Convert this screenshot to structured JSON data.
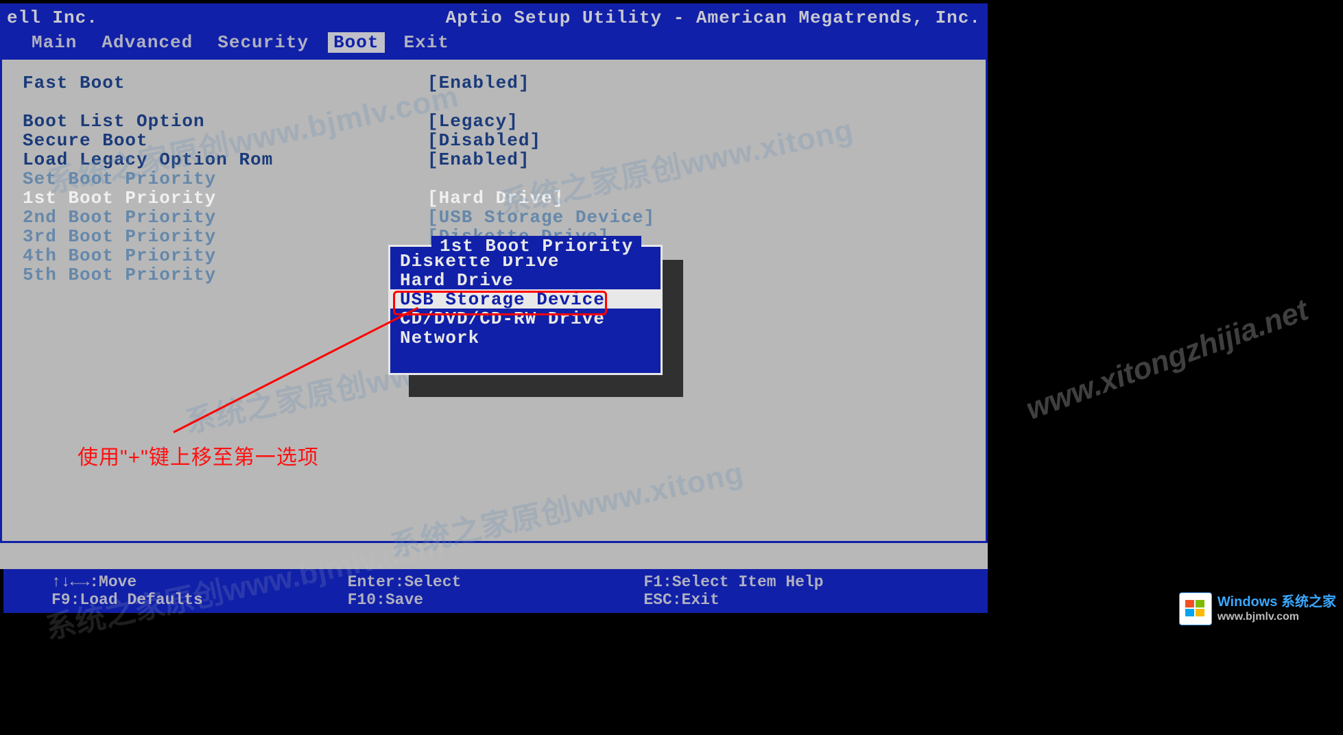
{
  "header": {
    "vendor": "ell Inc.",
    "utility": "Aptio Setup Utility - American Megatrends, Inc.",
    "tabs": [
      "Main",
      "Advanced",
      "Security",
      "Boot",
      "Exit"
    ],
    "active_tab": "Boot"
  },
  "options": {
    "fast_boot": {
      "label": "Fast Boot",
      "value": "[Enabled]"
    },
    "boot_list_option": {
      "label": "Boot List Option",
      "value": "[Legacy]"
    },
    "secure_boot": {
      "label": "Secure Boot",
      "value": "[Disabled]"
    },
    "load_legacy_rom": {
      "label": "Load Legacy Option Rom",
      "value": "[Enabled]"
    },
    "set_boot_priority": {
      "label": "Set Boot Priority",
      "value": ""
    },
    "boot1": {
      "label": "1st Boot Priority",
      "value": "[Hard Drive]"
    },
    "boot2": {
      "label": "2nd Boot Priority",
      "value": "[USB Storage Device]"
    },
    "boot3": {
      "label": "3rd Boot Priority",
      "value": "[Diskette Drive]"
    },
    "boot4": {
      "label": "4th Boot Priority",
      "value": ""
    },
    "boot5": {
      "label": "5th Boot Priority",
      "value": ""
    }
  },
  "popup": {
    "title": "1st Boot Priority",
    "items": [
      "Diskette Drive",
      "Hard Drive",
      "USB Storage Device",
      "CD/DVD/CD-RW Drive",
      "Network"
    ],
    "selected_index": 2
  },
  "annotation": {
    "text": "使用\"+\"键上移至第一选项"
  },
  "footer": {
    "move": "↑↓←→:Move",
    "enter": "Enter:Select",
    "f1": "F1:Select Item Help",
    "f9": "F9:Load Defaults",
    "f10": "F10:Save",
    "esc": "ESC:Exit"
  },
  "watermarks": {
    "wm1": "系统之家原创www.bjmlv.com",
    "wm2": "系统之家原创www.xitong",
    "wm3": "系统之家原创www.bjmlv.com",
    "wm4": "系统之家原创www.xitong",
    "wm5": "www.xitongzhijia.net"
  },
  "badge": {
    "line1": "Windows 系统之家",
    "line2": "www.bjmlv.com"
  }
}
